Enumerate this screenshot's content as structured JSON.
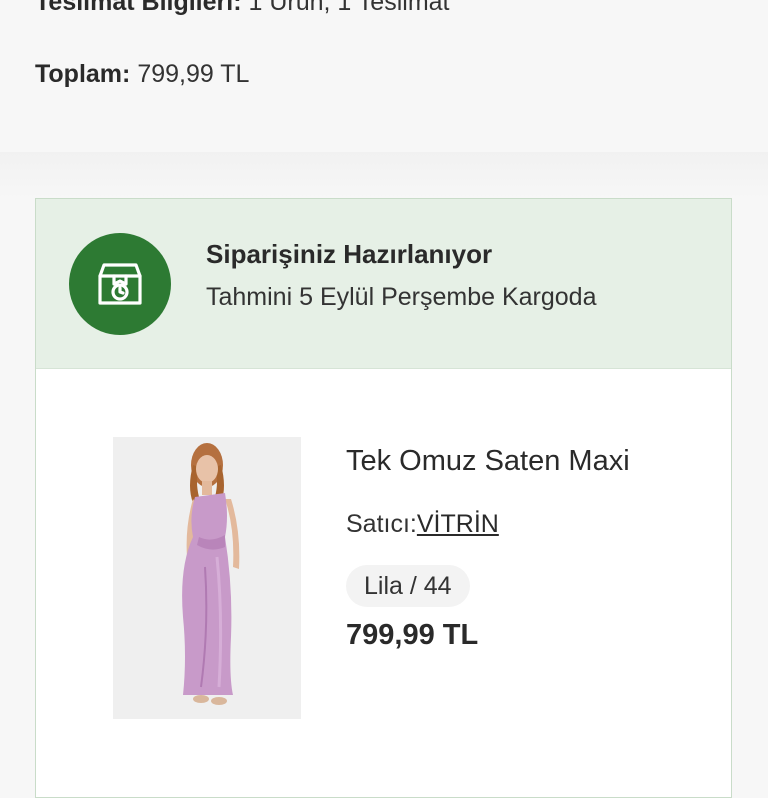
{
  "summary": {
    "delivery_label": "Teslimat Bilgileri:",
    "delivery_value": "1 Ürün, 1 Teslimat",
    "total_label": "Toplam:",
    "total_value": "799,99 TL"
  },
  "status": {
    "icon": "package-clock-icon",
    "title": "Siparişiniz Hazırlanıyor",
    "subtitle": "Tahmini 5 Eylül Perşembe Kargoda",
    "color": "#2d7a33",
    "background": "#e6f0e6"
  },
  "product": {
    "name": "Tek Omuz Saten Maxi",
    "seller_label": "Satıcı:",
    "seller_name": "VİTRİN",
    "variant": "Lila / 44",
    "price": "799,99 TL",
    "image": "product-photo"
  }
}
